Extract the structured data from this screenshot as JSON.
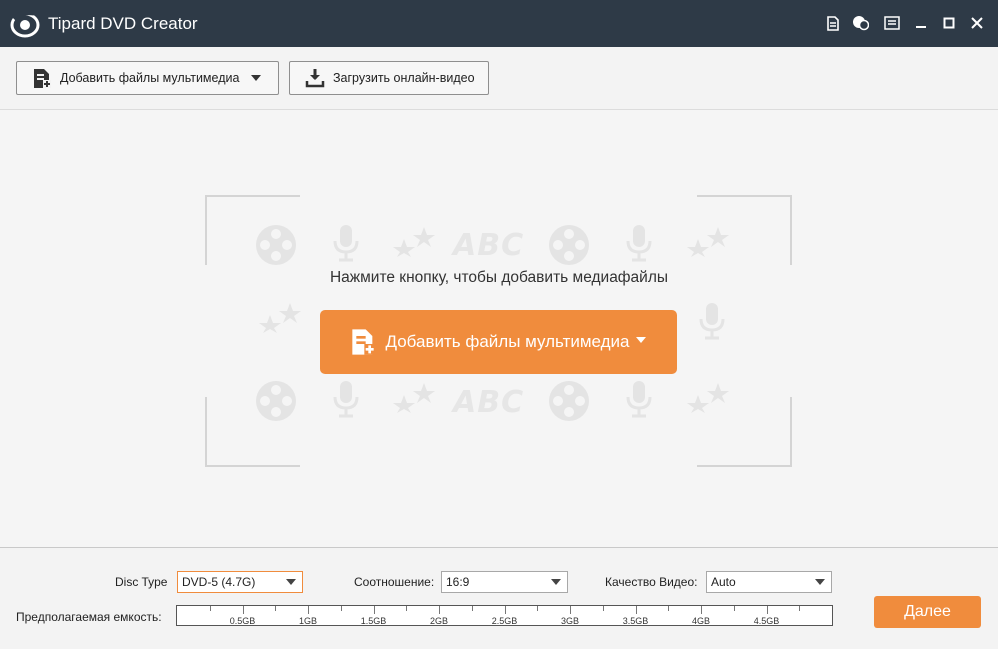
{
  "window": {
    "title": "Tipard DVD Creator",
    "controls": [
      "document-icon",
      "chat-icon",
      "menu-icon",
      "minimize-icon",
      "maximize-icon",
      "close-icon"
    ]
  },
  "toolbar": {
    "add_media_label": "Добавить файлы мультимедиа",
    "download_label": "Загрузить онлайн-видео"
  },
  "main": {
    "hint": "Нажмите кнопку, чтобы добавить медиафайлы",
    "add_button_label": "Добавить файлы мультимедиа",
    "decor_text": "ABC"
  },
  "bottom": {
    "disc_type_label": "Disc Type",
    "disc_type_value": "DVD-5 (4.7G)",
    "ratio_label": "Соотношение:",
    "ratio_value": "16:9",
    "quality_label": "Качество Видео:",
    "quality_value": "Auto",
    "capacity_label": "Предполагаемая емкость:",
    "capacity_ticks": [
      "0.5GB",
      "1GB",
      "1.5GB",
      "2GB",
      "2.5GB",
      "3GB",
      "3.5GB",
      "4GB",
      "4.5GB"
    ],
    "next_label": "Далее"
  },
  "colors": {
    "accent": "#f08c3d",
    "titlebar": "#2e3a47"
  }
}
